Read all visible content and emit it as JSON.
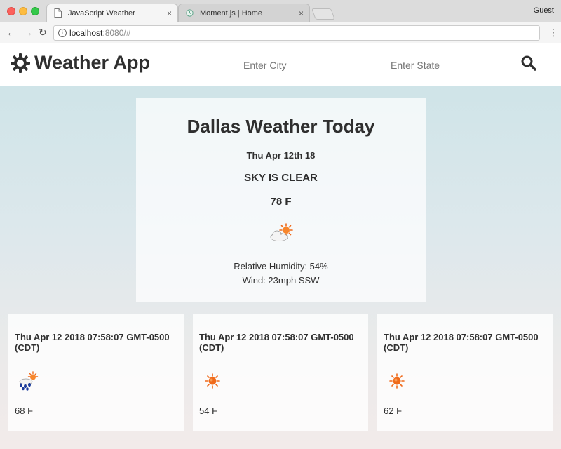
{
  "browser": {
    "tabs": [
      {
        "title": "JavaScript Weather",
        "close": "×"
      },
      {
        "title": "Moment.js | Home",
        "close": "×"
      }
    ],
    "profile": "Guest",
    "url_host": "localhost",
    "url_rest": ":8080/#",
    "nav": {
      "back": "←",
      "forward": "→",
      "reload": "↻",
      "menu": "⋮",
      "info": "i"
    }
  },
  "header": {
    "title": "Weather App",
    "city_placeholder": "Enter City",
    "state_placeholder": "Enter State",
    "icons": {
      "logo": "sun-gear-icon",
      "search": "search-icon"
    }
  },
  "today": {
    "title": "Dallas Weather Today",
    "date": "Thu Apr 12th 18",
    "description": "SKY IS CLEAR",
    "temp": "78 F",
    "icon": "cloud-sun-icon",
    "humidity": "Relative Humidity: 54%",
    "wind": "Wind: 23mph SSW"
  },
  "forecast": [
    {
      "date": "Thu Apr 12 2018 07:58:07 GMT-0500 (CDT)",
      "temp": "68 F",
      "icon": "rain-sun-icon"
    },
    {
      "date": "Thu Apr 12 2018 07:58:07 GMT-0500 (CDT)",
      "temp": "54 F",
      "icon": "sun-icon"
    },
    {
      "date": "Thu Apr 12 2018 07:58:07 GMT-0500 (CDT)",
      "temp": "62 F",
      "icon": "sun-icon"
    }
  ],
  "colors": {
    "accent_text": "#2f2f2f",
    "sun": "#f06a1a",
    "rain": "#1c3c9c"
  }
}
